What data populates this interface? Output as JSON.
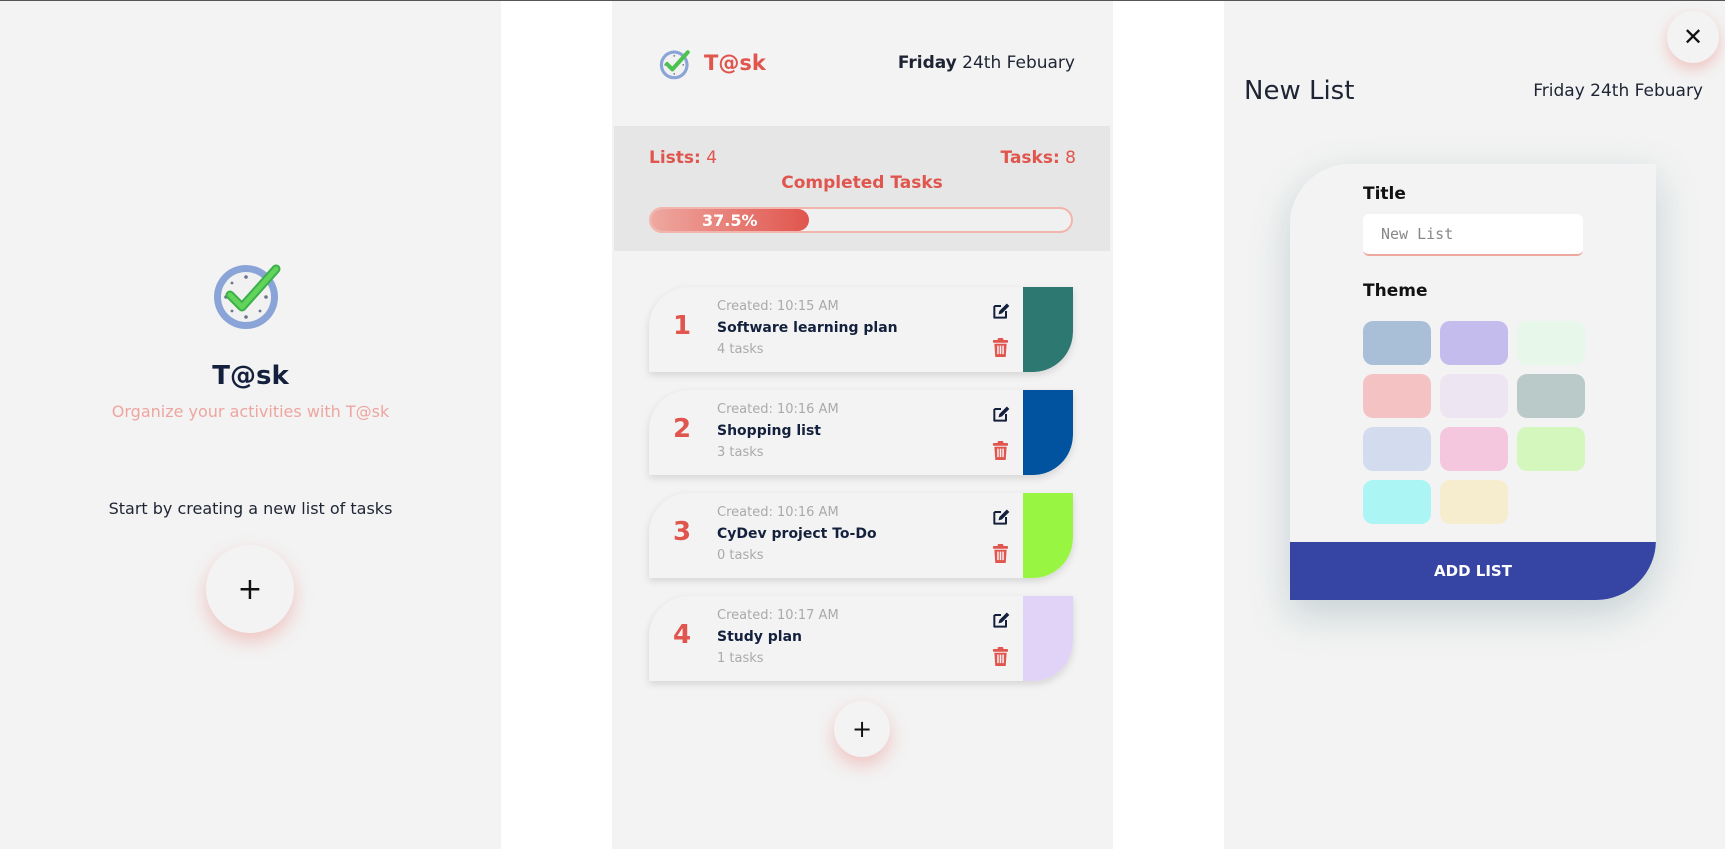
{
  "welcome": {
    "title": "T@sk",
    "subtitle": "Organize your activities with T@sk",
    "start_text": "Start by creating a new list of tasks",
    "add_label": "+"
  },
  "lists_screen": {
    "brand": "T@sk",
    "date_day": "Friday",
    "date_rest": " 24th Febuary",
    "lists_label": "Lists:",
    "lists_count": " 4",
    "tasks_label": "Tasks:",
    "tasks_count": " 8",
    "completed_label": "Completed Tasks",
    "progress_text": "37.5%",
    "progress_value": 37.5,
    "cards": [
      {
        "num": "1",
        "created": "Created: 10:15 AM",
        "title": "Software learning plan",
        "count": "4 tasks",
        "color": "#2e7872"
      },
      {
        "num": "2",
        "created": "Created: 10:16 AM",
        "title": "Shopping list",
        "count": "3 tasks",
        "color": "#02539f"
      },
      {
        "num": "3",
        "created": "Created: 10:16 AM",
        "title": "CyDev project To-Do",
        "count": "0 tasks",
        "color": "#98f541"
      },
      {
        "num": "4",
        "created": "Created: 10:17 AM",
        "title": "Study plan",
        "count": "1 tasks",
        "color": "#e1d3f8"
      }
    ],
    "add_label": "+"
  },
  "new_list": {
    "close_label": "✕",
    "heading": "New List",
    "date": "Friday 24th Febuary",
    "title_label": "Title",
    "title_placeholder": "New List",
    "theme_label": "Theme",
    "swatches": [
      "#a9bfd8",
      "#c4bcec",
      "#e7f7ea",
      "#f5c2c3",
      "#ede6f2",
      "#b9cac8",
      "#d3dcee",
      "#f5c7df",
      "#d3f7bd",
      "#abf5f4",
      "#f6ecce"
    ],
    "add_button": "ADD LIST"
  }
}
